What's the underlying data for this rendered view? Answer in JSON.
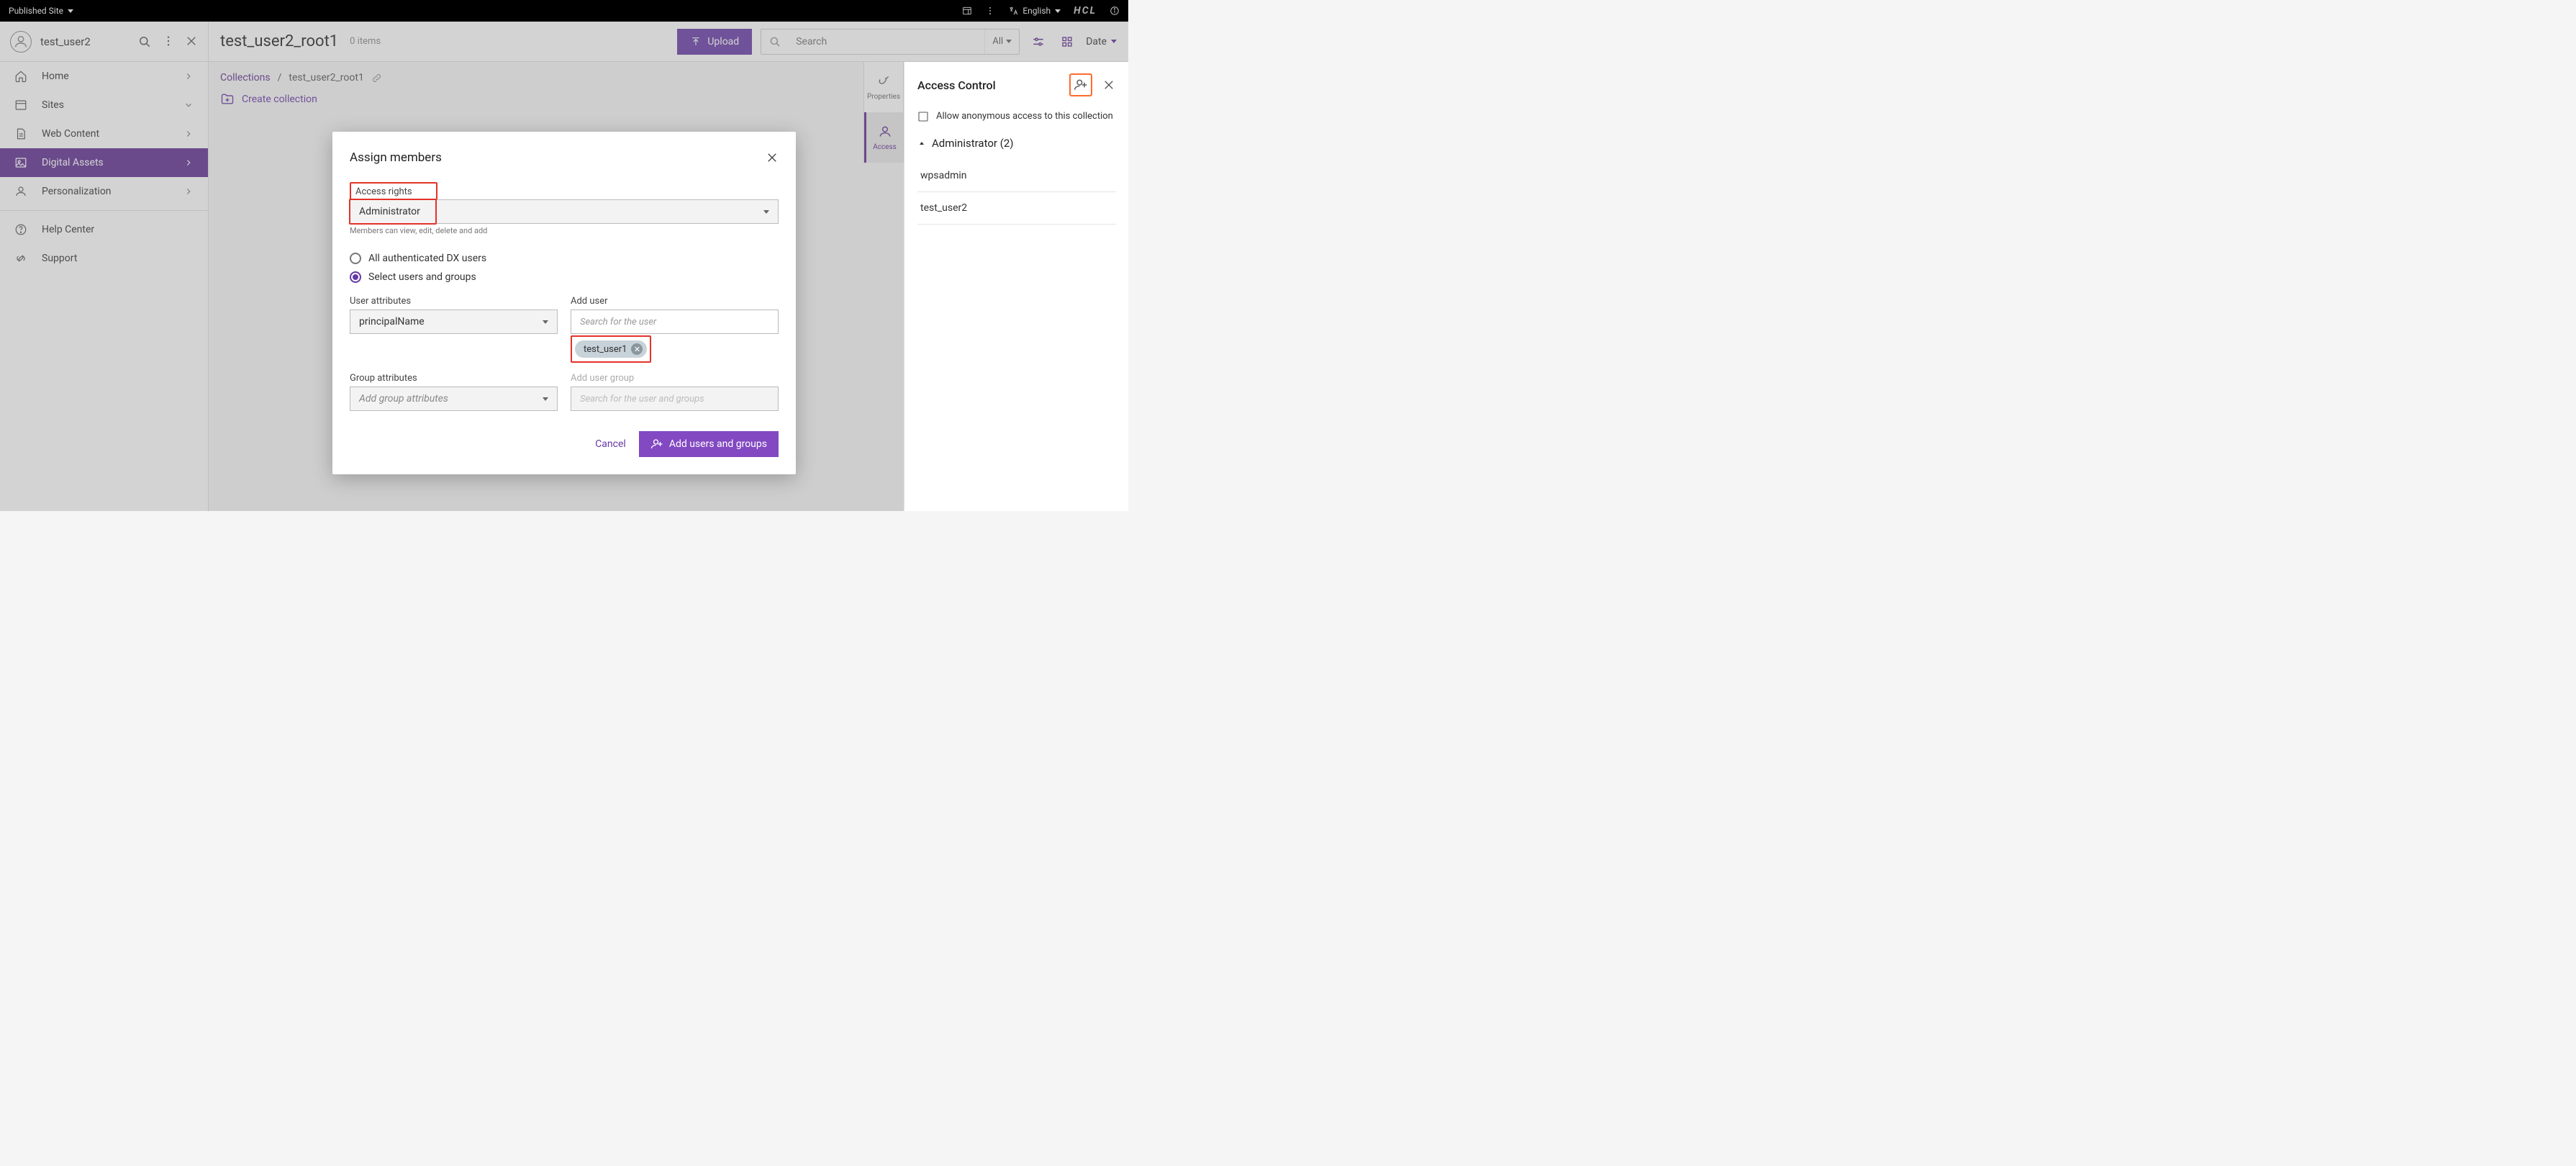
{
  "topbar": {
    "site_label": "Published Site",
    "language": "English"
  },
  "user": {
    "name": "test_user2"
  },
  "nav": {
    "home": "Home",
    "sites": "Sites",
    "web_content": "Web Content",
    "digital_assets": "Digital Assets",
    "personalization": "Personalization",
    "help_center": "Help Center",
    "support": "Support"
  },
  "header": {
    "title": "test_user2_root1",
    "items_count": "0 items",
    "upload": "Upload",
    "search_placeholder": "Search",
    "filter_all": "All",
    "sort_label": "Date"
  },
  "breadcrumb": {
    "root": "Collections",
    "current": "test_user2_root1"
  },
  "create_collection": "Create collection",
  "side_tabs": {
    "properties": "Properties",
    "access": "Access"
  },
  "access_panel": {
    "title": "Access Control",
    "allow_anon": "Allow anonymous access to this collection",
    "admin_section": "Administrator (2)",
    "members": [
      "wpsadmin",
      "test_user2"
    ]
  },
  "modal": {
    "title": "Assign members",
    "access_rights_label": "Access rights",
    "access_rights_value": "Administrator",
    "access_rights_helper": "Members can view, edit, delete and add",
    "radio_all_users": "All authenticated DX users",
    "radio_select_users": "Select users and groups",
    "user_attr_label": "User attributes",
    "user_attr_value": "principalName",
    "add_user_label": "Add user",
    "add_user_placeholder": "Search for the user",
    "chip_user": "test_user1",
    "group_attr_label": "Group attributes",
    "group_attr_placeholder": "Add group attributes",
    "add_group_label": "Add user group",
    "add_group_placeholder": "Search for the user and groups",
    "cancel": "Cancel",
    "submit": "Add users and groups"
  }
}
